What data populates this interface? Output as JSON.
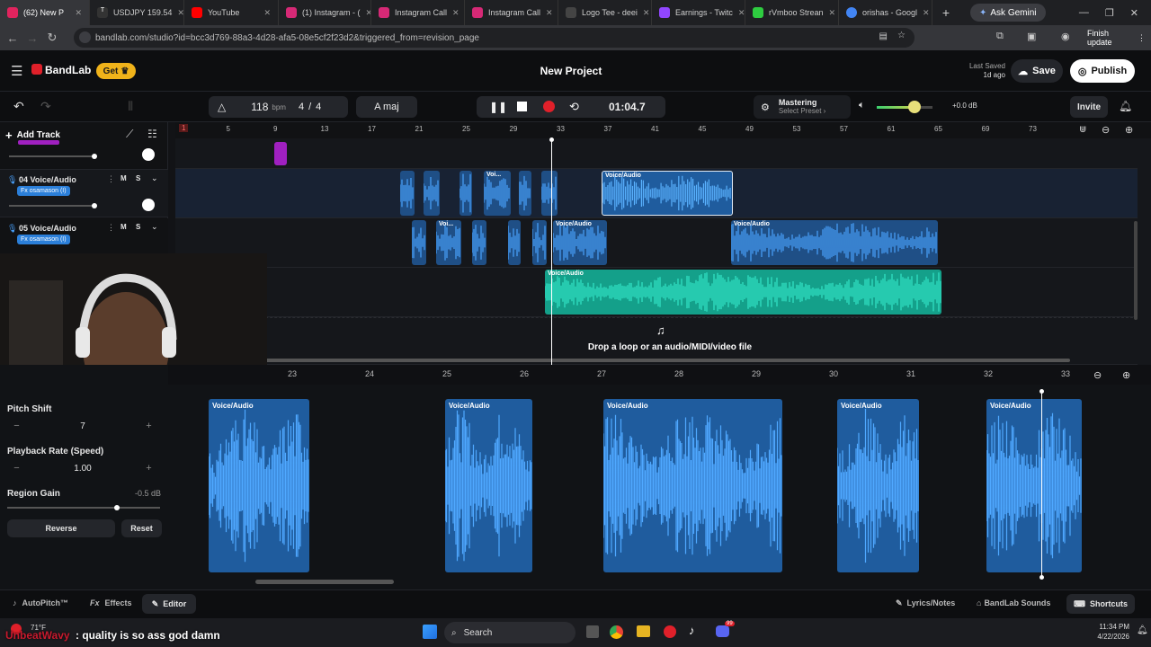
{
  "browser": {
    "tabs": [
      {
        "label": "(62) New P",
        "color": "#e0245e"
      },
      {
        "label": "USDJPY 159.54",
        "color": "#222"
      },
      {
        "label": "YouTube",
        "color": "#ff0000"
      },
      {
        "label": "(1) Instagram - (",
        "color": "#d62976"
      },
      {
        "label": "Instagram Call",
        "color": "#d62976"
      },
      {
        "label": "Instagram Call",
        "color": "#d62976"
      },
      {
        "label": "Logo Tee - deei",
        "color": "#444"
      },
      {
        "label": "Earnings - Twitc",
        "color": "#9146ff"
      },
      {
        "label": "rVmboo Strean",
        "color": "#2ecc40"
      },
      {
        "label": "orishas - Googl",
        "color": "#4285f4"
      }
    ],
    "new_tab": "+",
    "gemini": "Ask Gemini",
    "url": "bandlab.com/studio?id=bcc3d769-88a3-4d28-afa5-08e5cf2f23d2&triggered_from=revision_page",
    "finish_update": "Finish update"
  },
  "app": {
    "brand": "BandLab",
    "get_label": "Get",
    "project_title": "New Project",
    "last_saved_label": "Last Saved",
    "last_saved_value": "1d ago",
    "save_label": "Save",
    "publish_label": "Publish",
    "invite_label": "Invite",
    "bpm_value": "118",
    "bpm_unit": "bpm",
    "time_sig_num": "4",
    "time_sig_sep": "/",
    "time_sig_den": "4",
    "key": "A maj",
    "time": "01:04.7",
    "mastering_label": "Mastering",
    "mastering_sub": "Select Preset",
    "volume_db": "+0.0 dB",
    "add_track": "Add Track"
  },
  "ruler": {
    "marks": [
      "1",
      "5",
      "9",
      "13",
      "17",
      "21",
      "25",
      "29",
      "33",
      "37",
      "41",
      "45",
      "49",
      "53",
      "57",
      "61",
      "65",
      "69",
      "73"
    ]
  },
  "tracks": [
    {
      "number": "04",
      "name": "Voice/Audio",
      "fx": "osamason (I)",
      "m": "M",
      "s": "S"
    },
    {
      "number": "05",
      "name": "Voice/Audio",
      "fx": "osamason (I)",
      "m": "M",
      "s": "S"
    }
  ],
  "clips": {
    "voi": "Voi...",
    "voice_audio": "Voice/Audio"
  },
  "dropzone": "Drop a loop or an audio/MIDI/video file",
  "editor": {
    "ruler": [
      "23",
      "24",
      "25",
      "26",
      "27",
      "28",
      "29",
      "30",
      "31",
      "32",
      "33"
    ],
    "clip_label": "Voice/Audio",
    "pitch_shift_label": "Pitch Shift",
    "pitch_shift_value": "7",
    "playback_rate_label": "Playback Rate (Speed)",
    "playback_rate_value": "1.00",
    "region_gain_label": "Region Gain",
    "region_gain_value": "-0.5 dB",
    "region_gain_level": 0.72,
    "reverse_label": "Reverse",
    "reset_label": "Reset",
    "minus": "−",
    "plus": "+"
  },
  "bottom": {
    "autopitch": "AutoPitch™",
    "effects": "Effects",
    "editor": "Editor",
    "lyrics": "Lyrics/Notes",
    "sounds": "BandLab Sounds",
    "shortcuts": "Shortcuts"
  },
  "taskbar": {
    "weather": "71°F",
    "chat_user": "UnbeatWavy",
    "chat_msg": ": quality is so ass god damn",
    "search": "Search",
    "time": "11:34 PM",
    "date": "4/22/2026",
    "badge": "99"
  },
  "colors": {
    "accent_blue": "#2b7fd9",
    "teal": "#1fc4a6",
    "record_red": "#e0202a",
    "get_yellow": "#f0b31a"
  }
}
